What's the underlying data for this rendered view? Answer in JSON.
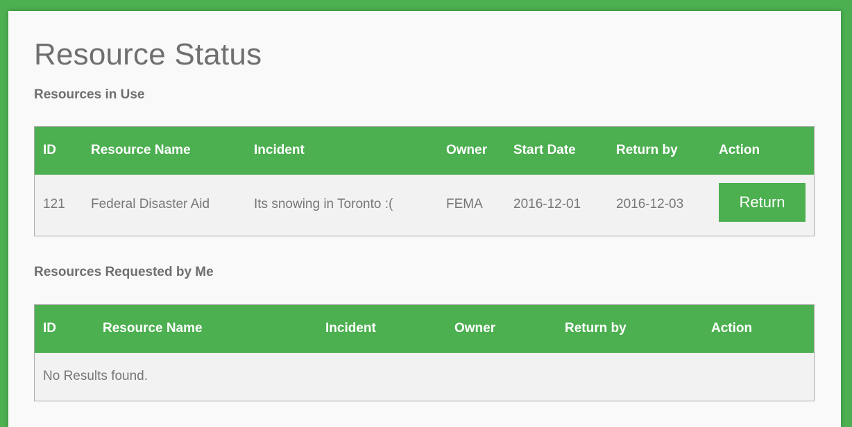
{
  "page": {
    "title": "Resource Status"
  },
  "in_use": {
    "title": "Resources in Use",
    "headers": [
      "ID",
      "Resource Name",
      "Incident",
      "Owner",
      "Start Date",
      "Return by",
      "Action"
    ],
    "rows": [
      {
        "id": "121",
        "resource_name": "Federal Disaster Aid",
        "incident": "Its snowing in Toronto :(",
        "owner": "FEMA",
        "start_date": "2016-12-01",
        "return_by": "2016-12-03",
        "action_label": "Return"
      }
    ]
  },
  "requested": {
    "title": "Resources Requested by Me",
    "headers": [
      "ID",
      "Resource Name",
      "Incident",
      "Owner",
      "Return by",
      "Action"
    ],
    "empty_message": "No Results found."
  },
  "colors": {
    "accent": "#4caf50",
    "card_background": "#f9f9f9",
    "table_body": "#f2f2f2",
    "text": "#777777"
  }
}
